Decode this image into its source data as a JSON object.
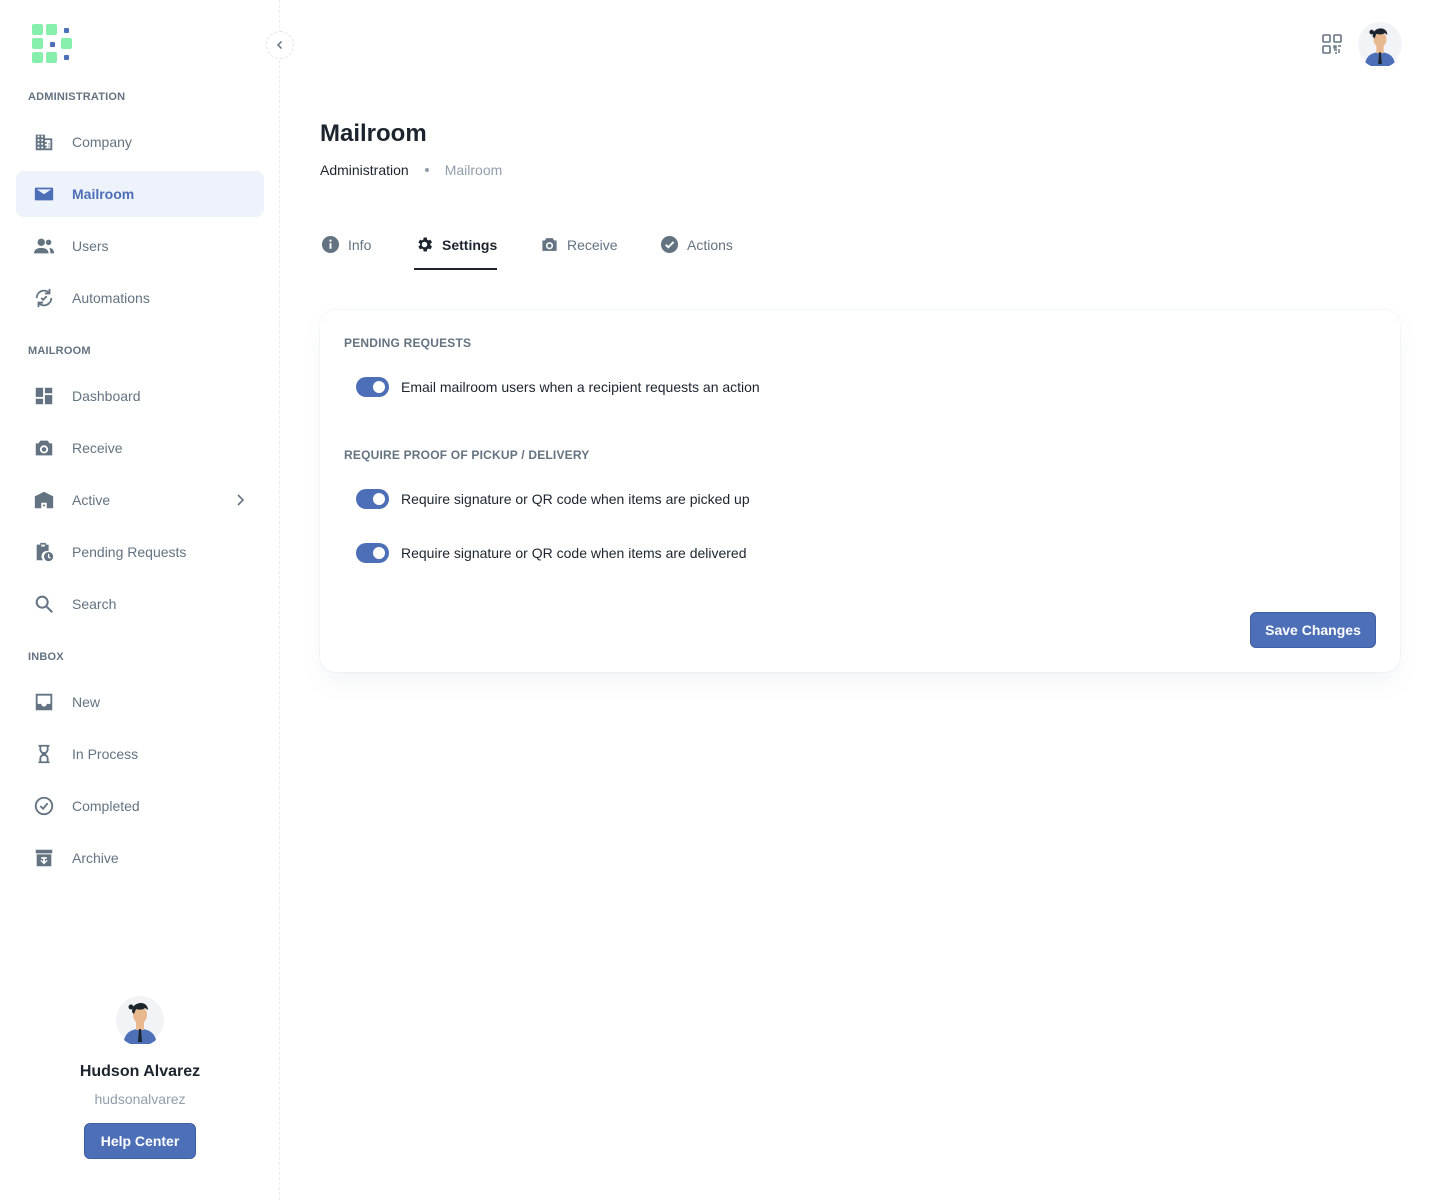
{
  "sidebar": {
    "sections": {
      "administration": "ADMINISTRATION",
      "mailroom": "MAILROOM",
      "inbox": "INBOX"
    },
    "items": {
      "company": "Company",
      "mailroom": "Mailroom",
      "users": "Users",
      "automations": "Automations",
      "dashboard": "Dashboard",
      "receive": "Receive",
      "active": "Active",
      "pending_requests": "Pending Requests",
      "search": "Search",
      "new": "New",
      "in_process": "In Process",
      "completed": "Completed",
      "archive": "Archive"
    },
    "active_item": "Mailroom"
  },
  "profile": {
    "name": "Hudson Alvarez",
    "handle": "hudsonalvarez",
    "help_label": "Help Center"
  },
  "header": {
    "title": "Mailroom",
    "breadcrumb": [
      "Administration",
      "Mailroom"
    ]
  },
  "tabs": [
    {
      "label": "Info",
      "icon": "info-icon"
    },
    {
      "label": "Settings",
      "icon": "gear-icon",
      "active": true
    },
    {
      "label": "Receive",
      "icon": "camera-icon"
    },
    {
      "label": "Actions",
      "icon": "check-circle-icon"
    }
  ],
  "settings": {
    "pending_title": "PENDING REQUESTS",
    "pending_toggles": [
      {
        "label": "Email mailroom users when a recipient requests an action",
        "on": true
      }
    ],
    "proof_title": "REQUIRE PROOF OF PICKUP / DELIVERY",
    "proof_toggles": [
      {
        "label": "Require signature or QR code when items are picked up",
        "on": true
      },
      {
        "label": "Require signature or QR code when items are delivered",
        "on": true
      }
    ],
    "save_label": "Save Changes"
  },
  "colors": {
    "accent": "#4d6fb7",
    "logo_green": "#86efac",
    "logo_blue": "#4d6fb7"
  }
}
